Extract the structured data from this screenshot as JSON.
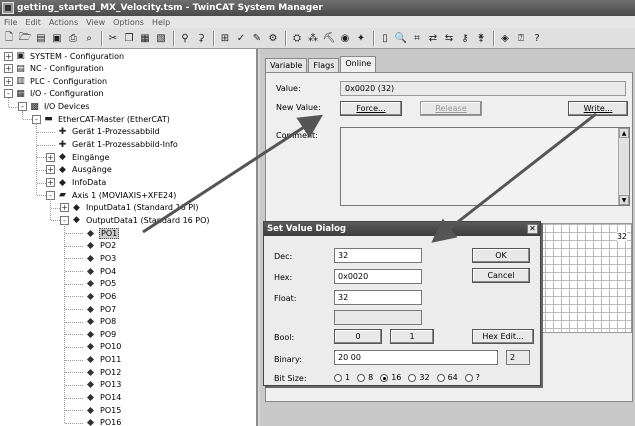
{
  "window": {
    "title": "getting_started_MX_Velocity.tsm - TwinCAT System Manager"
  },
  "menu": [
    "File",
    "Edit",
    "Actions",
    "View",
    "Options",
    "Help"
  ],
  "tree": [
    {
      "label": "SYSTEM - Configuration",
      "level": 0,
      "expander": "+",
      "icon": "system-icon"
    },
    {
      "label": "NC - Configuration",
      "level": 0,
      "expander": "+",
      "icon": "nc-icon"
    },
    {
      "label": "PLC - Configuration",
      "level": 0,
      "expander": "+",
      "icon": "plc-icon"
    },
    {
      "label": "I/O - Configuration",
      "level": 0,
      "expander": "-",
      "icon": "io-icon"
    },
    {
      "label": "I/O Devices",
      "level": 1,
      "expander": "-",
      "icon": "io-devices-icon"
    },
    {
      "label": "EtherCAT-Master (EtherCAT)",
      "level": 2,
      "expander": "-",
      "icon": "ethercat-master-icon"
    },
    {
      "label": "Gerät 1-Prozessabbild",
      "level": 3,
      "expander": "",
      "icon": "process-image-icon"
    },
    {
      "label": "Gerät 1-Prozessabbild-Info",
      "level": 3,
      "expander": "",
      "icon": "process-image-icon"
    },
    {
      "label": "Eingänge",
      "level": 3,
      "expander": "+",
      "icon": "inputs-icon"
    },
    {
      "label": "Ausgänge",
      "level": 3,
      "expander": "+",
      "icon": "outputs-icon"
    },
    {
      "label": "InfoData",
      "level": 3,
      "expander": "+",
      "icon": "infodata-icon"
    },
    {
      "label": "Axis 1 (MOVIAXIS+XFE24)",
      "level": 3,
      "expander": "-",
      "icon": "axis-icon"
    },
    {
      "label": "InputData1  (Standard 16 PI)",
      "level": 4,
      "expander": "+",
      "icon": "input-data-icon"
    },
    {
      "label": "OutputData1  (Standard 16 PO)",
      "level": 4,
      "expander": "-",
      "icon": "output-data-icon"
    },
    {
      "label": "PO1",
      "level": 5,
      "expander": "",
      "icon": "po-variable-icon",
      "selected": true
    },
    {
      "label": "PO2",
      "level": 5,
      "expander": "",
      "icon": "po-variable-icon"
    },
    {
      "label": "PO3",
      "level": 5,
      "expander": "",
      "icon": "po-variable-icon"
    },
    {
      "label": "PO4",
      "level": 5,
      "expander": "",
      "icon": "po-variable-linked-icon"
    },
    {
      "label": "PO5",
      "level": 5,
      "expander": "",
      "icon": "po-variable-icon"
    },
    {
      "label": "PO6",
      "level": 5,
      "expander": "",
      "icon": "po-variable-icon"
    },
    {
      "label": "PO7",
      "level": 5,
      "expander": "",
      "icon": "po-variable-icon"
    },
    {
      "label": "PO8",
      "level": 5,
      "expander": "",
      "icon": "po-variable-icon"
    },
    {
      "label": "PO9",
      "level": 5,
      "expander": "",
      "icon": "po-variable-icon"
    },
    {
      "label": "PO10",
      "level": 5,
      "expander": "",
      "icon": "po-variable-icon"
    },
    {
      "label": "PO11",
      "level": 5,
      "expander": "",
      "icon": "po-variable-icon"
    },
    {
      "label": "PO12",
      "level": 5,
      "expander": "",
      "icon": "po-variable-icon"
    },
    {
      "label": "PO13",
      "level": 5,
      "expander": "",
      "icon": "po-variable-icon"
    },
    {
      "label": "PO14",
      "level": 5,
      "expander": "",
      "icon": "po-variable-icon"
    },
    {
      "label": "PO15",
      "level": 5,
      "expander": "",
      "icon": "po-variable-icon"
    },
    {
      "label": "PO16",
      "level": 5,
      "expander": "",
      "icon": "po-variable-icon"
    }
  ],
  "tabs": [
    "Variable",
    "Flags",
    "Online"
  ],
  "online": {
    "value_label": "Value:",
    "value": "0x0020 (32)",
    "new_value_label": "New Value:",
    "force_label": "Force...",
    "release_label": "Release",
    "write_label": "Write...",
    "comment_label": "Comment:",
    "graph_value": "32"
  },
  "dialog": {
    "title": "Set Value Dialog",
    "dec_label": "Dec:",
    "dec_value": "32",
    "hex_label": "Hex:",
    "hex_value": "0x0020",
    "float_label": "Float:",
    "float_value": "32",
    "extra_value": "",
    "bool_label": "Bool:",
    "bool_0": "0",
    "bool_1": "1",
    "hex_edit_label": "Hex Edit...",
    "binary_label": "Binary:",
    "binary_value": "20 00",
    "binary_count": "2",
    "bitsize_label": "Bit Size:",
    "bitsize_options": [
      "1",
      "8",
      "16",
      "32",
      "64",
      "?"
    ],
    "bitsize_selected": "16",
    "ok_label": "OK",
    "cancel_label": "Cancel"
  }
}
